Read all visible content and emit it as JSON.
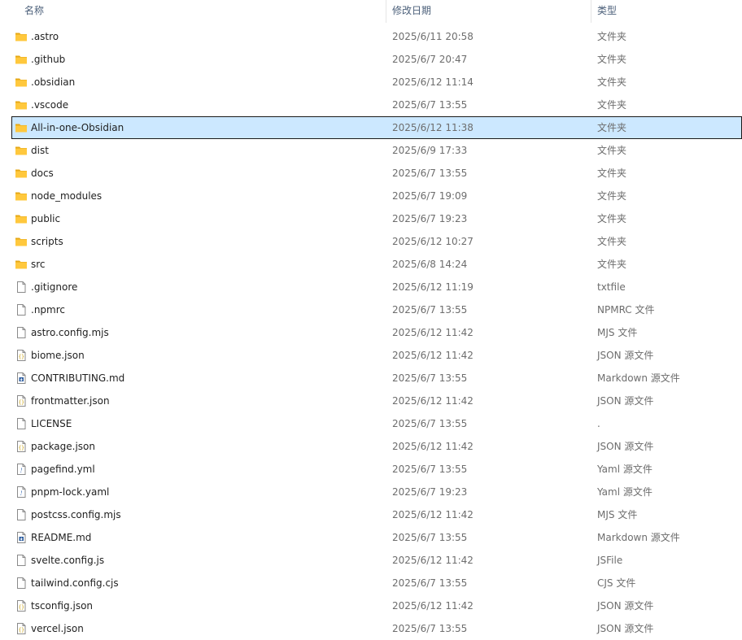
{
  "columns": {
    "name": "名称",
    "date": "修改日期",
    "type": "类型"
  },
  "selected_index": 4,
  "files": [
    {
      "name": ".astro",
      "date": "2025/6/11 20:58",
      "type": "文件夹",
      "icon": "folder-icon"
    },
    {
      "name": ".github",
      "date": "2025/6/7 20:47",
      "type": "文件夹",
      "icon": "folder-icon"
    },
    {
      "name": ".obsidian",
      "date": "2025/6/12 11:14",
      "type": "文件夹",
      "icon": "folder-icon"
    },
    {
      "name": ".vscode",
      "date": "2025/6/7 13:55",
      "type": "文件夹",
      "icon": "folder-icon"
    },
    {
      "name": "All-in-one-Obsidian",
      "date": "2025/6/12 11:38",
      "type": "文件夹",
      "icon": "folder-icon"
    },
    {
      "name": "dist",
      "date": "2025/6/9 17:33",
      "type": "文件夹",
      "icon": "folder-icon"
    },
    {
      "name": "docs",
      "date": "2025/6/7 13:55",
      "type": "文件夹",
      "icon": "folder-icon"
    },
    {
      "name": "node_modules",
      "date": "2025/6/7 19:09",
      "type": "文件夹",
      "icon": "folder-icon"
    },
    {
      "name": "public",
      "date": "2025/6/7 19:23",
      "type": "文件夹",
      "icon": "folder-icon"
    },
    {
      "name": "scripts",
      "date": "2025/6/12 10:27",
      "type": "文件夹",
      "icon": "folder-icon"
    },
    {
      "name": "src",
      "date": "2025/6/8 14:24",
      "type": "文件夹",
      "icon": "folder-icon"
    },
    {
      "name": ".gitignore",
      "date": "2025/6/12 11:19",
      "type": "txtfile",
      "icon": "file-icon"
    },
    {
      "name": ".npmrc",
      "date": "2025/6/7 13:55",
      "type": "NPMRC 文件",
      "icon": "file-icon"
    },
    {
      "name": "astro.config.mjs",
      "date": "2025/6/12 11:42",
      "type": "MJS 文件",
      "icon": "file-icon"
    },
    {
      "name": "biome.json",
      "date": "2025/6/12 11:42",
      "type": "JSON 源文件",
      "icon": "json-file-icon"
    },
    {
      "name": "CONTRIBUTING.md",
      "date": "2025/6/7 13:55",
      "type": "Markdown 源文件",
      "icon": "markdown-file-icon"
    },
    {
      "name": "frontmatter.json",
      "date": "2025/6/12 11:42",
      "type": "JSON 源文件",
      "icon": "json-file-icon"
    },
    {
      "name": "LICENSE",
      "date": "2025/6/7 13:55",
      "type": ".",
      "icon": "file-icon"
    },
    {
      "name": "package.json",
      "date": "2025/6/12 11:42",
      "type": "JSON 源文件",
      "icon": "json-file-icon"
    },
    {
      "name": "pagefind.yml",
      "date": "2025/6/7 13:55",
      "type": "Yaml 源文件",
      "icon": "yaml-file-icon"
    },
    {
      "name": "pnpm-lock.yaml",
      "date": "2025/6/7 19:23",
      "type": "Yaml 源文件",
      "icon": "yaml-file-icon"
    },
    {
      "name": "postcss.config.mjs",
      "date": "2025/6/12 11:42",
      "type": "MJS 文件",
      "icon": "file-icon"
    },
    {
      "name": "README.md",
      "date": "2025/6/7 13:55",
      "type": "Markdown 源文件",
      "icon": "markdown-file-icon"
    },
    {
      "name": "svelte.config.js",
      "date": "2025/6/12 11:42",
      "type": "JSFile",
      "icon": "file-icon"
    },
    {
      "name": "tailwind.config.cjs",
      "date": "2025/6/7 13:55",
      "type": "CJS 文件",
      "icon": "file-icon"
    },
    {
      "name": "tsconfig.json",
      "date": "2025/6/12 11:42",
      "type": "JSON 源文件",
      "icon": "json-file-icon"
    },
    {
      "name": "vercel.json",
      "date": "2025/6/7 13:55",
      "type": "JSON 源文件",
      "icon": "json-file-icon"
    }
  ],
  "colors": {
    "selection_bg": "#cce8ff",
    "header_text": "#4c607a",
    "secondary_text": "#6d6d6d",
    "folder_fill": "#ffc83d",
    "folder_tab": "#e6a817"
  }
}
